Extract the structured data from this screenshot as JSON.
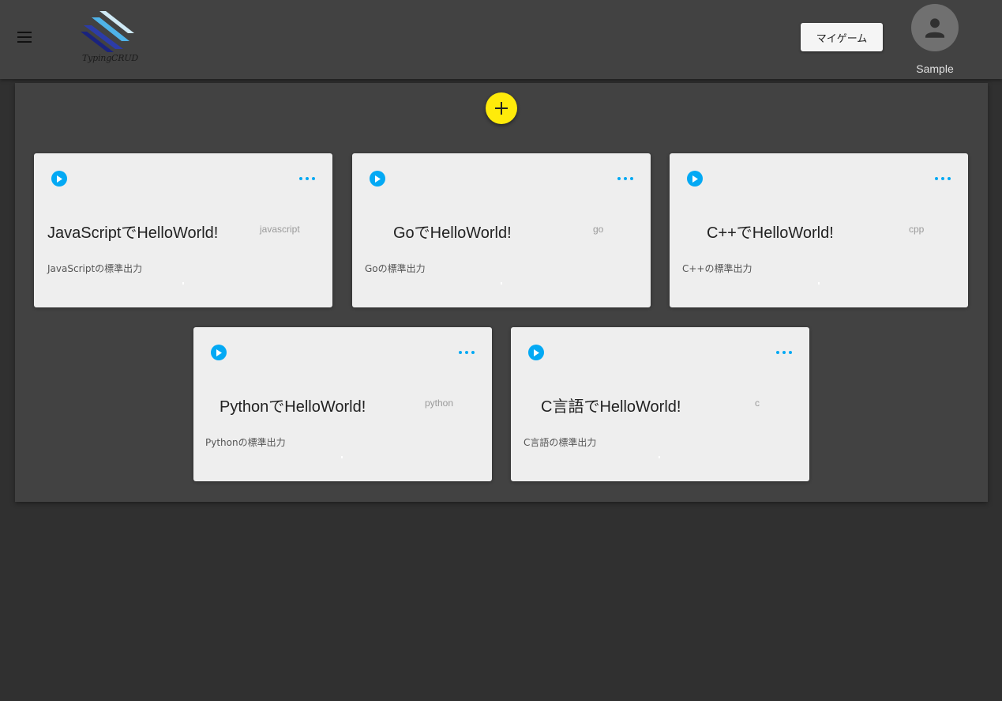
{
  "header": {
    "logo_text": "TypingCRUD",
    "my_game_label": "マイゲーム",
    "username": "Sample"
  },
  "colors": {
    "background": "#303030",
    "surface": "#424242",
    "card": "#eeeeee",
    "accent_blue": "#03a9f4",
    "fab_yellow": "#ffeb0a"
  },
  "icons": {
    "menu": "hamburger-menu-icon",
    "add": "plus-icon",
    "play": "play-circle-icon",
    "more": "more-horizontal-icon",
    "avatar": "person-icon"
  },
  "cards": [
    {
      "title": "JavaScriptでHelloWorld!",
      "language": "javascript",
      "description": "JavaScriptの標準出力"
    },
    {
      "title": "GoでHelloWorld!",
      "language": "go",
      "description": "Goの標準出力"
    },
    {
      "title": "C++でHelloWorld!",
      "language": "cpp",
      "description": "C++の標準出力"
    },
    {
      "title": "PythonでHelloWorld!",
      "language": "python",
      "description": "Pythonの標準出力"
    },
    {
      "title": "C言語でHelloWorld!",
      "language": "c",
      "description": "C言語の標準出力"
    }
  ]
}
